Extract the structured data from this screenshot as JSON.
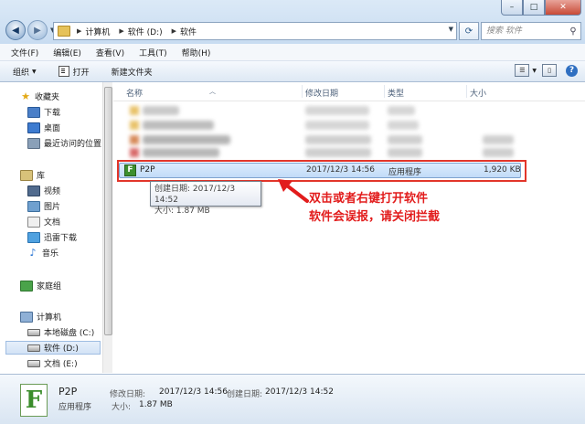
{
  "address": {
    "crumbs": [
      "计算机",
      "软件 (D:)",
      "软件"
    ]
  },
  "search": {
    "placeholder": "搜索 软件"
  },
  "menu": [
    "文件(F)",
    "编辑(E)",
    "查看(V)",
    "工具(T)",
    "帮助(H)"
  ],
  "commands": {
    "organize": "组织",
    "open": "打开",
    "new_folder": "新建文件夹"
  },
  "nav": {
    "favorites": "收藏夹",
    "downloads": "下载",
    "desktop": "桌面",
    "recent": "最近访问的位置",
    "libraries": "库",
    "videos": "视频",
    "pictures": "图片",
    "documents": "文档",
    "thunder": "迅雷下载",
    "music": "音乐",
    "homegroup": "家庭组",
    "computer": "计算机",
    "drive_c": "本地磁盘 (C:)",
    "drive_d": "软件 (D:)",
    "drive_e": "文档 (E:)"
  },
  "columns": {
    "name": "名称",
    "modified": "修改日期",
    "type": "类型",
    "size": "大小"
  },
  "file": {
    "name": "P2P",
    "modified": "2017/12/3 14:56",
    "type": "应用程序",
    "size": "1,920 KB",
    "icon_letter": "F"
  },
  "tooltip": {
    "created": "创建日期: 2017/12/3 14:52",
    "size": "大小: 1.87 MB"
  },
  "annotation": {
    "line1": "双击或者右键打开软件",
    "line2": "软件会误报，请关闭拦截",
    "color": "#e21c1c"
  },
  "details": {
    "name": "P2P",
    "type": "应用程序",
    "modified_label": "修改日期:",
    "modified": "2017/12/3 14:56",
    "created_label": "创建日期:",
    "created": "2017/12/3 14:52",
    "size_label": "大小:",
    "size": "1.87 MB"
  }
}
